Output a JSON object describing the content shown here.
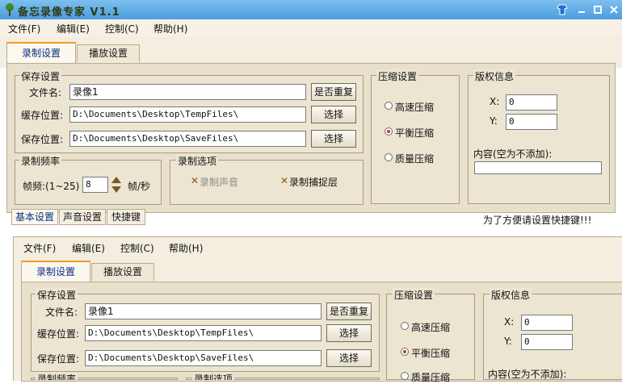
{
  "app": {
    "title": "备忘录像专家 V1.1"
  },
  "menu": {
    "file": "文件(F)",
    "edit": "编辑(E)",
    "control": "控制(C)",
    "help": "帮助(H)"
  },
  "tabs": {
    "record": "录制设置",
    "play": "播放设置"
  },
  "save": {
    "title": "保存设置",
    "file_label": "文件名:",
    "file_value": "录像1",
    "repeat_button": "是否重复",
    "cache_label": "缓存位置:",
    "cache_value": "D:\\Documents\\Desktop\\TempFiles\\",
    "save_label": "保存位置:",
    "save_value": "D:\\Documents\\Desktop\\SaveFiles\\",
    "choose_button": "选择"
  },
  "compress": {
    "title": "压缩设置",
    "fast": "高速压缩",
    "balanced": "平衡压缩",
    "quality": "质量压缩",
    "selected": "balanced"
  },
  "copyright": {
    "title": "版权信息",
    "x_label": "X:",
    "x_value": "0",
    "y_label": "Y:",
    "y_value": "0",
    "content_label": "内容(空为不添加):",
    "content_value": ""
  },
  "freq": {
    "title": "录制频率",
    "label": "帧频:(1~25)",
    "value": "8",
    "unit": "帧/秒"
  },
  "options": {
    "title": "录制选项",
    "sound": "录制声音",
    "layer": "录制捕捉层"
  },
  "bottom_tabs": {
    "basic": "基本设置",
    "sound": "声音设置",
    "hotkey": "快捷键"
  },
  "hint": "为了方便请设置快捷键!!!",
  "colors": {
    "titlebar": "#4b9ce0",
    "panel": "#e8e0cc",
    "tab_accent": "#f39a21"
  }
}
